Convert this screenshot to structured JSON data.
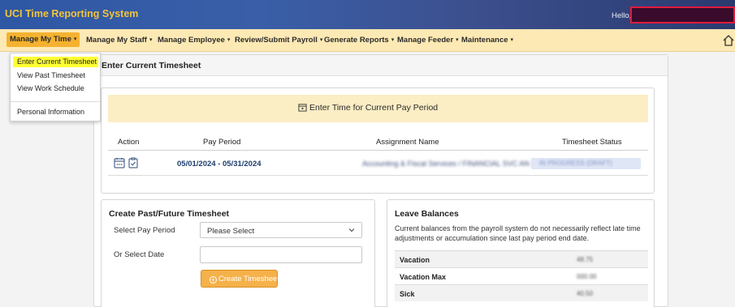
{
  "header": {
    "app_title": "UCI Time Reporting System",
    "greeting": "Hello,"
  },
  "menu": [
    {
      "label": "Manage My Time",
      "active": true
    },
    {
      "label": "Manage My Staff"
    },
    {
      "label": "Manage Employee"
    },
    {
      "label": "Review/Submit Payroll"
    },
    {
      "label": "Generate Reports"
    },
    {
      "label": "Manage Feeder"
    },
    {
      "label": "Maintenance"
    }
  ],
  "dropdown": {
    "items": [
      "Enter Current Timesheet",
      "View Past Timesheet",
      "View Work Schedule",
      "Personal Information"
    ]
  },
  "main": {
    "title": "Enter Current Timesheet"
  },
  "timesheet": {
    "banner": "Enter Time for Current Pay Period",
    "columns": [
      "Action",
      "Pay Period",
      "Assignment Name",
      "Timesheet Status"
    ],
    "row": {
      "pay_period": "05/01/2024 - 05/31/2024",
      "assignment": "Accounting & Fiscal Services / FINANCIAL SVC AN 3",
      "status": "IN PROGRESS (DRAFT)"
    }
  },
  "create_past": {
    "title": "Create Past/Future Timesheet",
    "select_pay_period_label": "Select Pay Period",
    "select_value": "Please Select",
    "or_select_date_label": "Or Select Date",
    "create_button": "Create Timesheet"
  },
  "leave": {
    "title": "Leave Balances",
    "description": "Current balances from the payroll system do not necessarily reflect late time adjustments or accumulation since last pay period end date.",
    "rows": [
      {
        "name": "Vacation",
        "amount": "48.75"
      },
      {
        "name": "Vacation Max",
        "amount": "000.00"
      },
      {
        "name": "Sick",
        "amount": "40.50"
      }
    ]
  },
  "colors": {
    "header_bg": "#3a5fa8",
    "app_title": "#f3c33c",
    "menu_bg": "#fde9b4",
    "menu_active": "#f5b230",
    "banner_bg": "#fbedc4",
    "button_bg": "#f5b14a",
    "dropdown_highlight": "#ffff33",
    "link": "#1d3d6e"
  },
  "icons": [
    "home-icon",
    "calendar-icon",
    "clipboard-check-icon",
    "calendar-clock-icon",
    "chevron-down-icon",
    "plus-circle-icon"
  ]
}
